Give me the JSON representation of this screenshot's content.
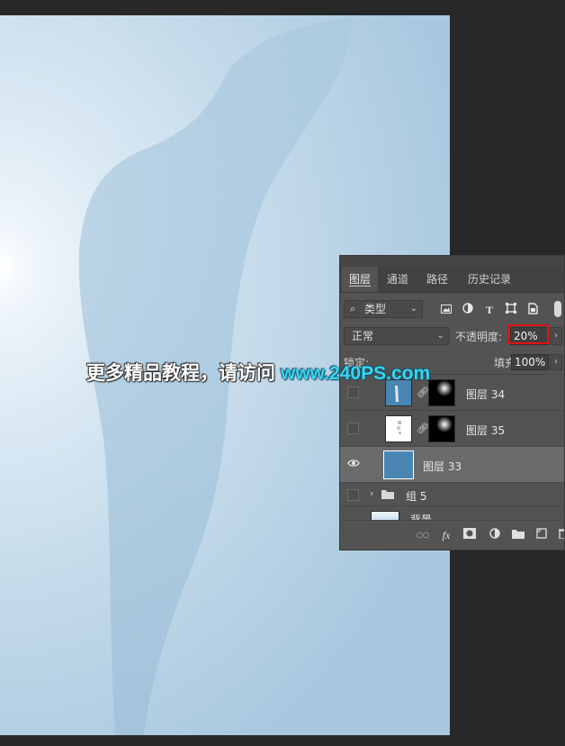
{
  "colors": {
    "accent_red": "#e01010",
    "url_cyan": "#34d6f0",
    "layer33_fill": "#4a86b4"
  },
  "watermark": {
    "cn": "更多精品教程，请访问",
    "url": "www.240PS.com"
  },
  "panel": {
    "tabs": [
      "图层",
      "通道",
      "路径",
      "历史记录"
    ],
    "filter": {
      "label": "类型",
      "icons": [
        "image-icon",
        "adjustment-icon",
        "type-icon",
        "shape-icon",
        "smart-object-icon"
      ]
    },
    "blend_mode": "正常",
    "opacity": {
      "label": "不透明度:",
      "value": "20%"
    },
    "lock_label": "锁定:",
    "fill": {
      "label": "填充:",
      "value": "100%"
    },
    "layers": [
      {
        "name": "图层 34",
        "visible": false,
        "selected": false,
        "has_mask": true
      },
      {
        "name": "图层 35",
        "visible": false,
        "selected": false,
        "has_mask": true
      },
      {
        "name": "图层 33",
        "visible": true,
        "selected": true,
        "has_mask": false
      },
      {
        "name": "组 5",
        "visible": false,
        "selected": false,
        "is_group": true
      },
      {
        "name": "背景",
        "visible": false,
        "selected": false,
        "has_mask": false
      }
    ],
    "footer_icons": [
      "link-icon",
      "fx-icon",
      "mask-icon",
      "adjustment-layer-icon",
      "group-folder-icon",
      "new-layer-icon",
      "trash-icon"
    ]
  }
}
